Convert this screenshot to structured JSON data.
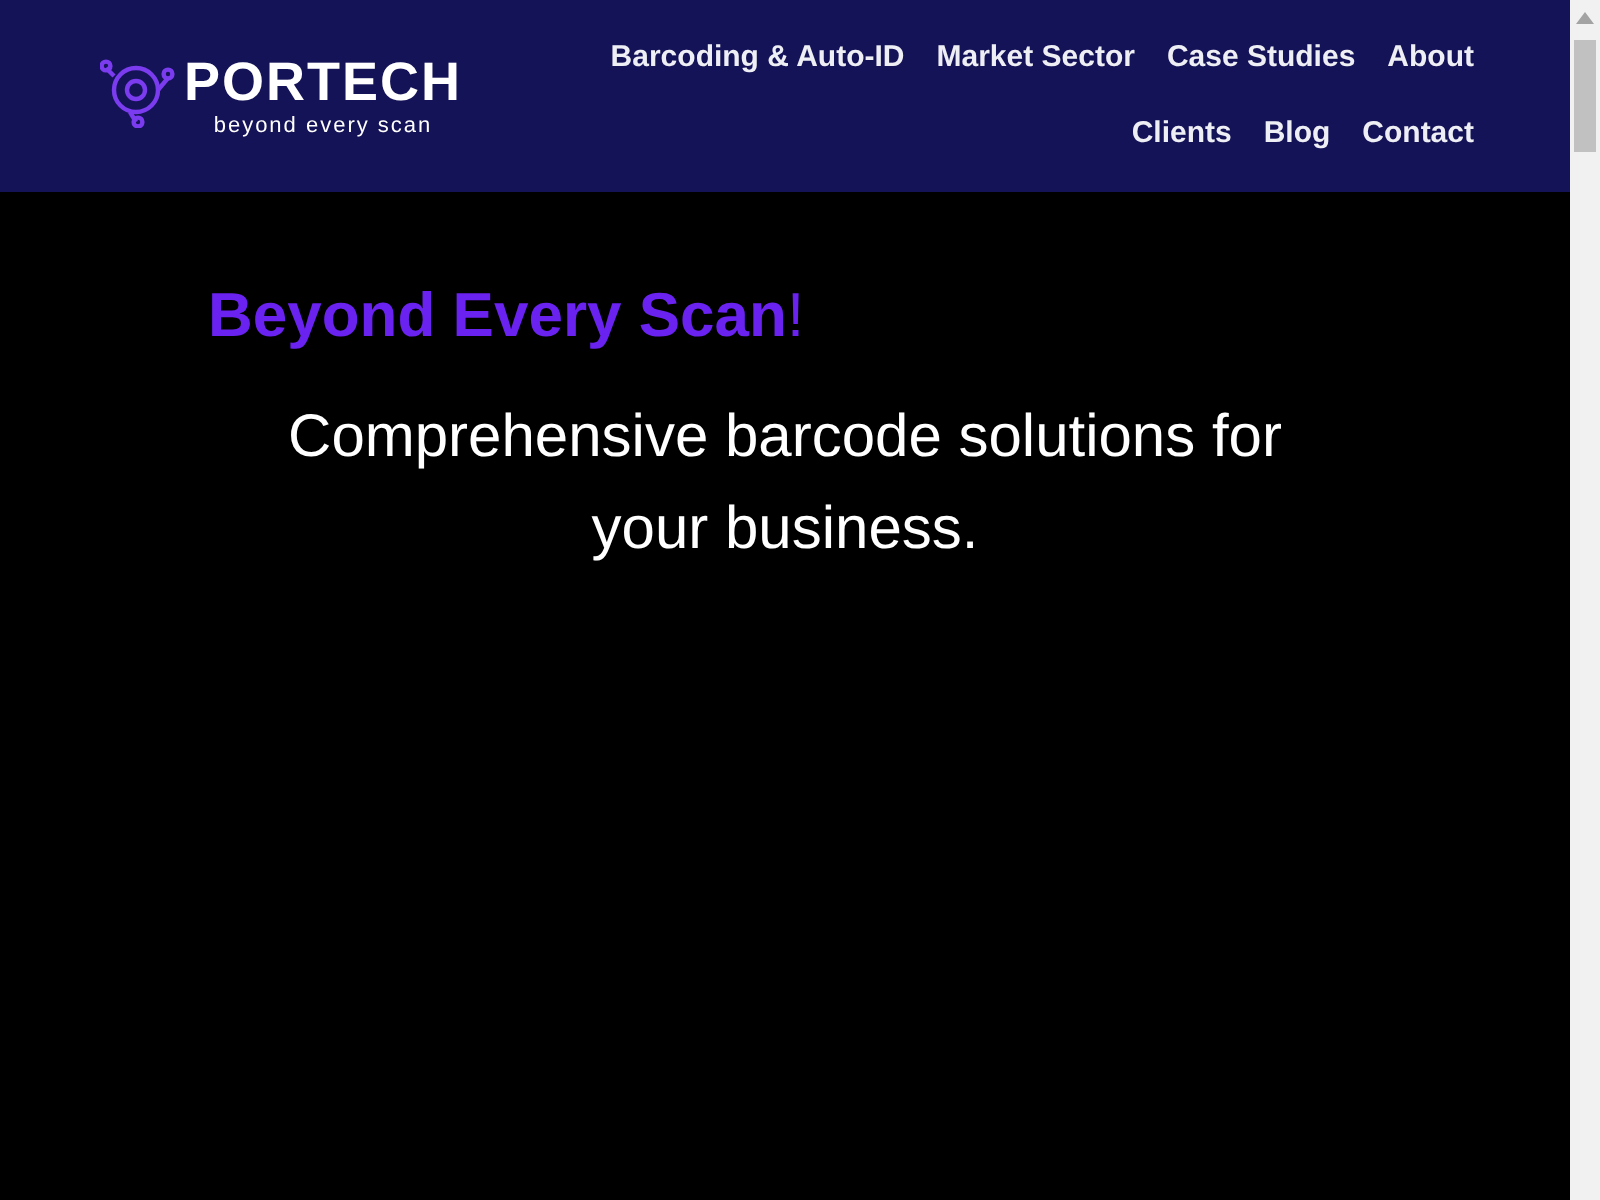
{
  "logo": {
    "name": "PORTECH",
    "tagline": "beyond every scan"
  },
  "nav": {
    "links": [
      "Barcoding & Auto-ID",
      "Market Sector",
      "Case Studies",
      "About",
      "Clients",
      "Blog",
      "Contact"
    ]
  },
  "hero": {
    "heading": "**Beyond Every Scan**!",
    "subtitle": "Comprehensive barcode solutions for your business."
  }
}
